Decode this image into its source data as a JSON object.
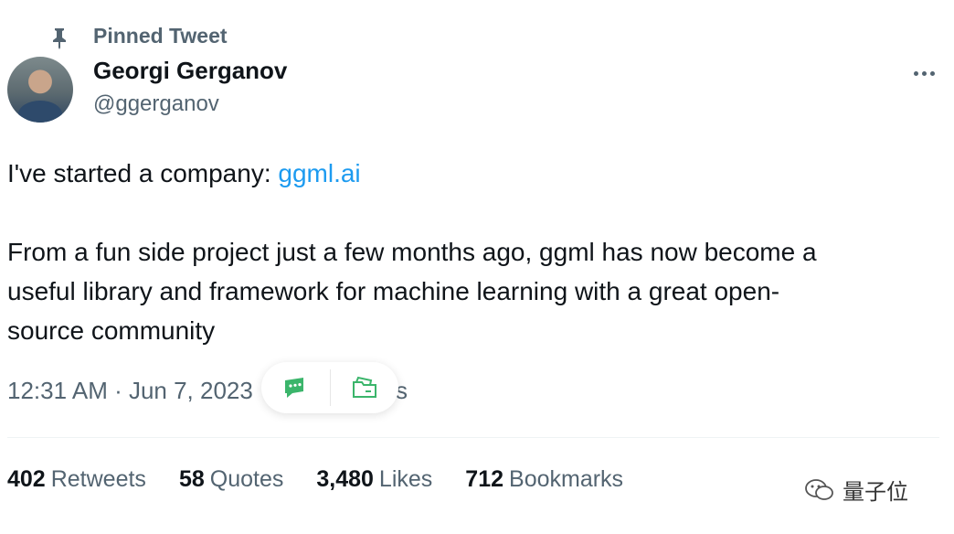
{
  "pinned": {
    "label": "Pinned Tweet",
    "icon": "pin-icon"
  },
  "author": {
    "name": "Georgi Gerganov",
    "handle": "@ggerganov"
  },
  "tweet": {
    "line1_prefix": "I've started a company: ",
    "line1_link": "ggml.ai",
    "line2": "From a fun side project just a few months ago, ggml has now become a",
    "line3": "useful library and framework for machine learning with a great open-",
    "line4": "source community"
  },
  "meta": {
    "timestamp": "12:31 AM · Jun 7, 2023 ·",
    "views_fragment": "vs"
  },
  "stats": [
    {
      "count": "402",
      "label": "Retweets"
    },
    {
      "count": "58",
      "label": "Quotes"
    },
    {
      "count": "3,480",
      "label": "Likes"
    },
    {
      "count": "712",
      "label": "Bookmarks"
    }
  ],
  "watermark": {
    "text": "量子位"
  },
  "colors": {
    "link": "#1d9bf0",
    "secondary_text": "#536471",
    "primary_text": "#0f1419",
    "overlay_icon": "#3bb56b"
  }
}
